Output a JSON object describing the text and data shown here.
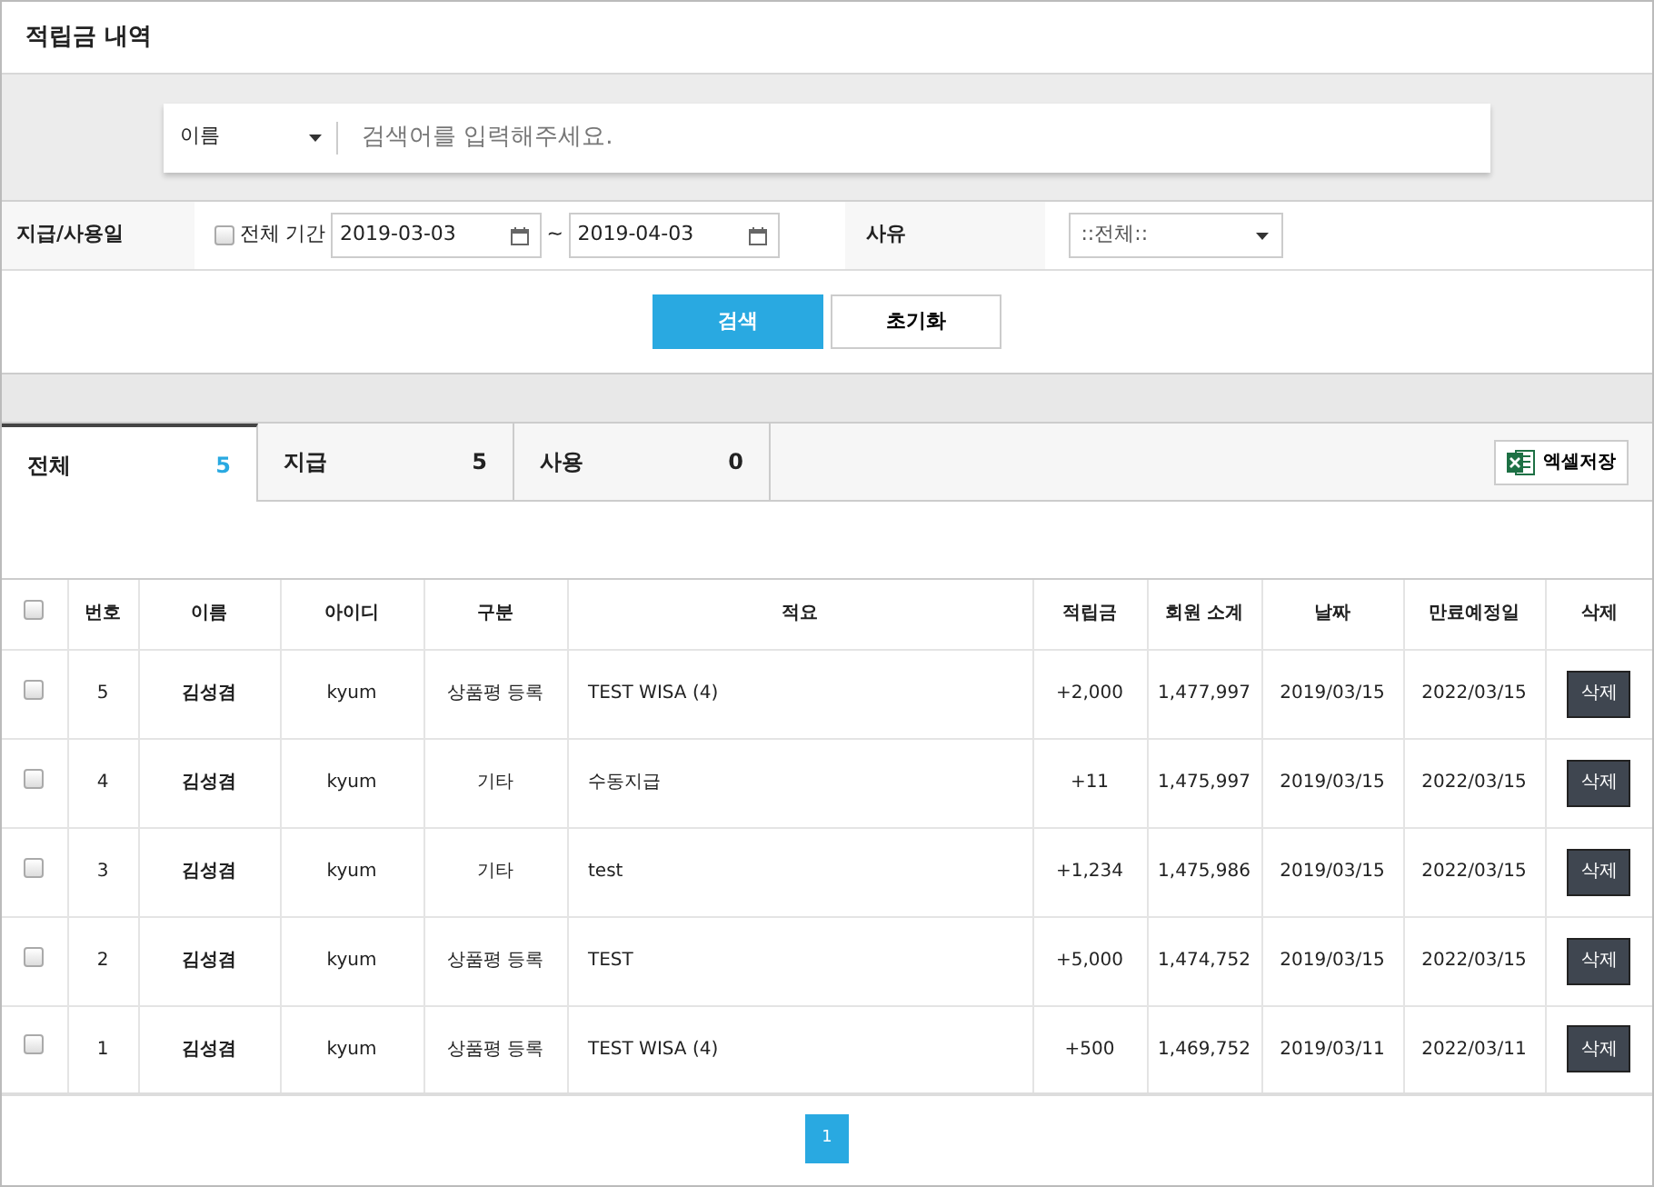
{
  "page_title": "적립금 내역",
  "search": {
    "field_select": "이름",
    "placeholder": "검색어를 입력해주세요."
  },
  "filters": {
    "date_label": "지급/사용일",
    "all_period": {
      "label": "전체 기간",
      "checked": false
    },
    "date_from": "2019-03-03",
    "date_sep": "~",
    "date_to": "2019-04-03",
    "reason_label": "사유",
    "reason_select": "::전체::"
  },
  "buttons": {
    "search": "검색",
    "reset": "초기화"
  },
  "tabs": [
    {
      "label": "전체",
      "count": "5",
      "selected": true
    },
    {
      "label": "지급",
      "count": "5",
      "selected": false
    },
    {
      "label": "사용",
      "count": "0",
      "selected": false
    }
  ],
  "excel_button": "엑셀저장",
  "table": {
    "select_all_checked": false,
    "columns": [
      "번호",
      "이름",
      "아이디",
      "구분",
      "적요",
      "적립금",
      "회원 소계",
      "날짜",
      "만료예정일",
      "삭제"
    ],
    "rows": [
      {
        "checked": false,
        "cells": [
          "5",
          "김성겸",
          "kyum",
          "상품평 등록",
          "TEST WISA (4)",
          "+2,000",
          "1,477,997",
          "2019/03/15",
          "2022/03/15"
        ],
        "action": "삭제"
      },
      {
        "checked": false,
        "cells": [
          "4",
          "김성겸",
          "kyum",
          "기타",
          "수동지급",
          "+11",
          "1,475,997",
          "2019/03/15",
          "2022/03/15"
        ],
        "action": "삭제"
      },
      {
        "checked": false,
        "cells": [
          "3",
          "김성겸",
          "kyum",
          "기타",
          "test",
          "+1,234",
          "1,475,986",
          "2019/03/15",
          "2022/03/15"
        ],
        "action": "삭제"
      },
      {
        "checked": false,
        "cells": [
          "2",
          "김성겸",
          "kyum",
          "상품평 등록",
          "TEST",
          "+5,000",
          "1,474,752",
          "2019/03/15",
          "2022/03/15"
        ],
        "action": "삭제"
      },
      {
        "checked": false,
        "cells": [
          "1",
          "김성겸",
          "kyum",
          "상품평 등록",
          "TEST WISA (4)",
          "+500",
          "1,469,752",
          "2019/03/11",
          "2022/03/11"
        ],
        "action": "삭제"
      }
    ]
  },
  "pagination": [
    {
      "label": "1",
      "selected": true
    }
  ]
}
